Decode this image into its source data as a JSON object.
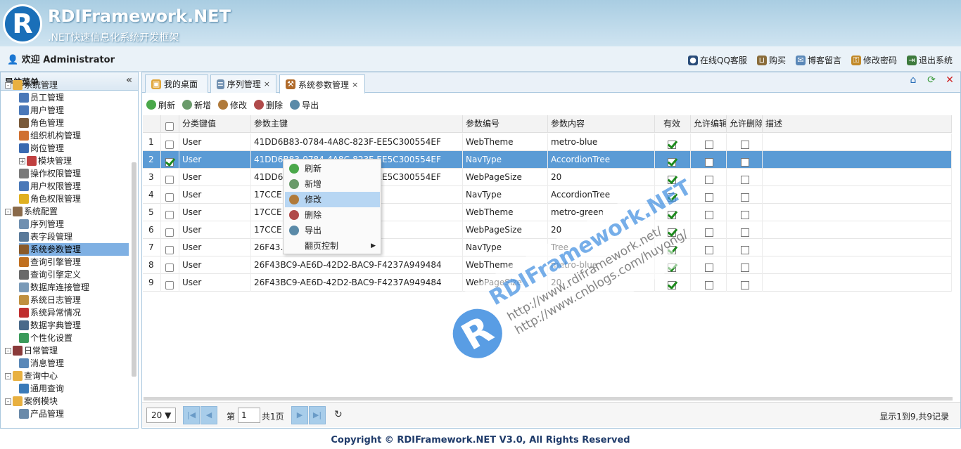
{
  "header": {
    "brand": "RDIFramework.NET",
    "tagline": ".NET快速信息化系统开发框架",
    "logo_letter": "R",
    "welcome": "欢迎 Administrator",
    "links": [
      {
        "label": "在线QQ客服",
        "icon": "person-icon"
      },
      {
        "label": "购买",
        "icon": "cart-icon"
      },
      {
        "label": "博客留言",
        "icon": "mail-icon"
      },
      {
        "label": "修改密码",
        "icon": "key-icon"
      },
      {
        "label": "退出系统",
        "icon": "exit-icon"
      }
    ]
  },
  "sidebar": {
    "title": "导航菜单",
    "collapse": "«",
    "items": [
      {
        "label": "系统管理",
        "icon": "folder-icon",
        "toggle": "-"
      },
      {
        "label": "员工管理",
        "icon": "user-icon"
      },
      {
        "label": "用户管理",
        "icon": "user-icon"
      },
      {
        "label": "角色管理",
        "icon": "users-icon"
      },
      {
        "label": "组织机构管理",
        "icon": "org-icon"
      },
      {
        "label": "岗位管理",
        "icon": "users-icon"
      },
      {
        "label": "模块管理",
        "icon": "grid-icon",
        "toggle": "+"
      },
      {
        "label": "操作权限管理",
        "icon": "list-icon"
      },
      {
        "label": "用户权限管理",
        "icon": "user-key-icon"
      },
      {
        "label": "角色权限管理",
        "icon": "lightning-icon"
      },
      {
        "label": "系统配置",
        "icon": "tools-icon",
        "toggle": "-"
      },
      {
        "label": "序列管理",
        "icon": "sequence-icon"
      },
      {
        "label": "表字段管理",
        "icon": "table-icon"
      },
      {
        "label": "系统参数管理",
        "icon": "params-icon"
      },
      {
        "label": "查询引擎管理",
        "icon": "engine-icon"
      },
      {
        "label": "查询引擎定义",
        "icon": "doc-icon"
      },
      {
        "label": "数据库连接管理",
        "icon": "db-icon"
      },
      {
        "label": "系统日志管理",
        "icon": "log-icon"
      },
      {
        "label": "系统异常情况",
        "icon": "error-icon"
      },
      {
        "label": "数据字典管理",
        "icon": "dict-icon"
      },
      {
        "label": "个性化设置",
        "icon": "personal-icon"
      },
      {
        "label": "日常管理",
        "icon": "calendar-icon",
        "toggle": "-"
      },
      {
        "label": "消息管理",
        "icon": "mail-icon"
      },
      {
        "label": "查询中心",
        "icon": "search-folder-icon",
        "toggle": "-"
      },
      {
        "label": "通用查询",
        "icon": "search-icon"
      },
      {
        "label": "案例模块",
        "icon": "folder-icon",
        "toggle": "-"
      },
      {
        "label": "产品管理",
        "icon": "product-icon"
      }
    ]
  },
  "tabs": [
    {
      "label": "我的桌面",
      "closable": false
    },
    {
      "label": "序列管理",
      "closable": true
    },
    {
      "label": "系统参数管理",
      "closable": true
    }
  ],
  "tab_close": "×",
  "toolbar": {
    "refresh": "刷新",
    "add": "新增",
    "edit": "修改",
    "delete": "删除",
    "export": "导出"
  },
  "grid": {
    "columns": [
      "分类键值",
      "参数主键",
      "参数编号",
      "参数内容",
      "有效",
      "允许编辑",
      "允许删除",
      "描述"
    ],
    "rows": [
      {
        "n": "1",
        "cat": "User",
        "key": "41DD6B83-0784-4A8C-823F-EE5C300554EF",
        "code": "WebTheme",
        "content": "metro-blue",
        "valid": true,
        "edit": false,
        "del": false,
        "selected": false
      },
      {
        "n": "2",
        "cat": "User",
        "key": "41DD6B83-0784-4A8C-823F-EE5C300554EF",
        "code": "NavType",
        "content": "AccordionTree",
        "valid": true,
        "edit": false,
        "del": false,
        "selected": true
      },
      {
        "n": "3",
        "cat": "User",
        "key": "41DD6B83-0784-4A8C-823F-EE5C300554EF",
        "code": "WebPageSize",
        "content": "20",
        "valid": true,
        "edit": false,
        "del": false,
        "selected": false
      },
      {
        "n": "4",
        "cat": "User",
        "key": "17CCE…0D7996F9DD48",
        "code": "NavType",
        "content": "AccordionTree",
        "valid": true,
        "edit": false,
        "del": false,
        "selected": false
      },
      {
        "n": "5",
        "cat": "User",
        "key": "17CCE…0D7996F9DD48",
        "code": "WebTheme",
        "content": "metro-green",
        "valid": true,
        "edit": false,
        "del": false,
        "selected": false
      },
      {
        "n": "6",
        "cat": "User",
        "key": "17CCE…0D7996F9DD48",
        "code": "WebPageSize",
        "content": "20",
        "valid": true,
        "edit": false,
        "del": false,
        "selected": false
      },
      {
        "n": "7",
        "cat": "User",
        "key": "26F43…F4237A949484",
        "code": "NavType",
        "content": "Tree",
        "valid": true,
        "edit": false,
        "del": false,
        "selected": false
      },
      {
        "n": "8",
        "cat": "User",
        "key": "26F43BC9-AE6D-42D2-BAC9-F4237A949484",
        "code": "WebTheme",
        "content": "metro-blue",
        "valid": true,
        "edit": false,
        "del": false,
        "selected": false
      },
      {
        "n": "9",
        "cat": "User",
        "key": "26F43BC9-AE6D-42D2-BAC9-F4237A949484",
        "code": "WebPageSize",
        "content": "20",
        "valid": true,
        "edit": false,
        "del": false,
        "selected": false
      }
    ]
  },
  "context_menu": {
    "items": [
      "刷新",
      "新增",
      "修改",
      "删除",
      "导出",
      "翻页控制"
    ],
    "submenu_arrow": "▶"
  },
  "pager": {
    "page_size": "20 ▼",
    "page_label": "第",
    "page_value": "1",
    "total_pages": "共1页",
    "info": "显示1到9,共9记录"
  },
  "watermark": {
    "title": "RDIFramework.NET",
    "url1": "http://www.rdiframework.net/",
    "url2": "http://www.cnblogs.com/huyong/",
    "letter": "R"
  },
  "footer": "Copyright © RDIFramework.NET V3.0, All Rights Reserved",
  "colors": {
    "selected_row": "#5b9bd5",
    "menu_hover": "#b7d6f3",
    "brand_blue": "#1a6fb8"
  }
}
